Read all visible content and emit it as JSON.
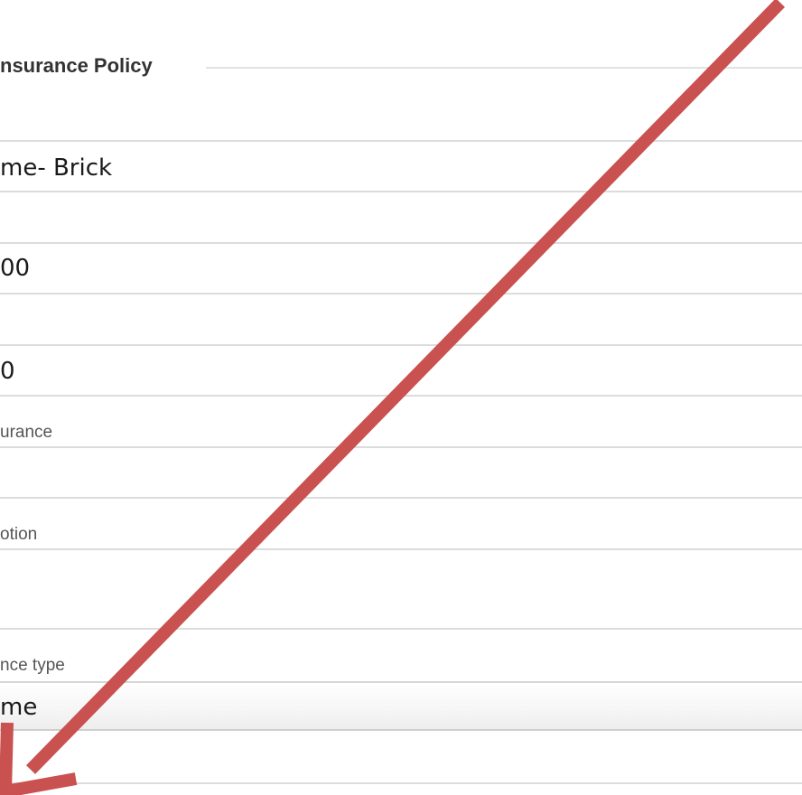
{
  "form": {
    "legend": "nsurance Policy",
    "fields": [
      {
        "value": "me- Brick"
      },
      {
        "value": "00"
      },
      {
        "value": "0"
      },
      {
        "label": "urance"
      },
      {
        "label": "otion"
      },
      {
        "label": "nce type",
        "selected": "me"
      }
    ]
  },
  "annotation": {
    "arrow_color": "#c9514f",
    "description": "arrow"
  }
}
